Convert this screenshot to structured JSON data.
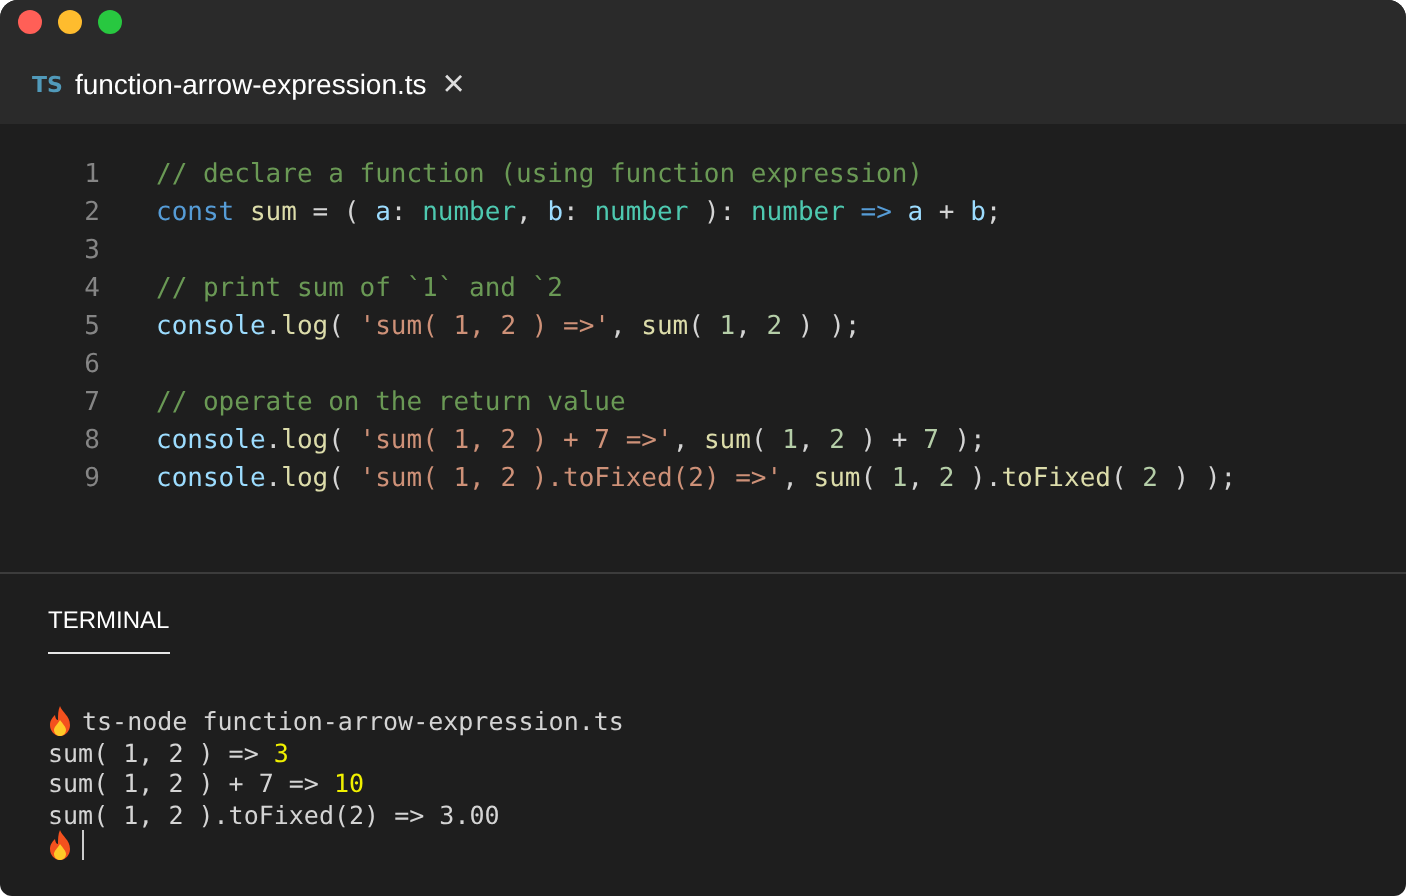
{
  "tab": {
    "badge": "TS",
    "title": "function-arrow-expression.ts",
    "close": "×"
  },
  "editor": {
    "lines": [
      {
        "number": "1",
        "tokens": [
          {
            "kind": "comment",
            "t": "// declare a function (using function expression)"
          }
        ]
      },
      {
        "number": "2",
        "tokens": [
          {
            "kind": "keyword",
            "t": "const "
          },
          {
            "kind": "func",
            "t": "sum"
          },
          {
            "kind": "plain",
            "t": " = ( "
          },
          {
            "kind": "param",
            "t": "a"
          },
          {
            "kind": "plain",
            "t": ": "
          },
          {
            "kind": "type",
            "t": "number"
          },
          {
            "kind": "plain",
            "t": ", "
          },
          {
            "kind": "param",
            "t": "b"
          },
          {
            "kind": "plain",
            "t": ": "
          },
          {
            "kind": "type",
            "t": "number"
          },
          {
            "kind": "plain",
            "t": " ): "
          },
          {
            "kind": "type",
            "t": "number "
          },
          {
            "kind": "keyword",
            "t": "=> "
          },
          {
            "kind": "param",
            "t": "a"
          },
          {
            "kind": "plain",
            "t": " + "
          },
          {
            "kind": "param",
            "t": "b"
          },
          {
            "kind": "plain",
            "t": ";"
          }
        ]
      },
      {
        "number": "3"
      },
      {
        "number": "4",
        "tokens": [
          {
            "kind": "comment",
            "t": "// print sum of `1` and `2"
          }
        ]
      },
      {
        "number": "5",
        "tokens": [
          {
            "kind": "param",
            "t": "console"
          },
          {
            "kind": "plain",
            "t": "."
          },
          {
            "kind": "func",
            "t": "log"
          },
          {
            "kind": "plain",
            "t": "( "
          },
          {
            "kind": "str",
            "t": "'sum( 1, 2 ) =>'"
          },
          {
            "kind": "plain",
            "t": ", "
          },
          {
            "kind": "func",
            "t": "sum"
          },
          {
            "kind": "plain",
            "t": "( "
          },
          {
            "kind": "num",
            "t": "1"
          },
          {
            "kind": "plain",
            "t": ", "
          },
          {
            "kind": "num",
            "t": "2"
          },
          {
            "kind": "plain",
            "t": " ) );"
          }
        ]
      },
      {
        "number": "6"
      },
      {
        "number": "7",
        "tokens": [
          {
            "kind": "comment",
            "t": "// operate on the return value"
          }
        ]
      },
      {
        "number": "8",
        "tokens": [
          {
            "kind": "param",
            "t": "console"
          },
          {
            "kind": "plain",
            "t": "."
          },
          {
            "kind": "func",
            "t": "log"
          },
          {
            "kind": "plain",
            "t": "( "
          },
          {
            "kind": "str",
            "t": "'sum( 1, 2 ) + 7 =>'"
          },
          {
            "kind": "plain",
            "t": ", "
          },
          {
            "kind": "func",
            "t": "sum"
          },
          {
            "kind": "plain",
            "t": "( "
          },
          {
            "kind": "num",
            "t": "1"
          },
          {
            "kind": "plain",
            "t": ", "
          },
          {
            "kind": "num",
            "t": "2"
          },
          {
            "kind": "plain",
            "t": " ) + "
          },
          {
            "kind": "num",
            "t": "7"
          },
          {
            "kind": "plain",
            "t": " );"
          }
        ]
      },
      {
        "number": "9",
        "tokens": [
          {
            "kind": "param",
            "t": "console"
          },
          {
            "kind": "plain",
            "t": "."
          },
          {
            "kind": "func",
            "t": "log"
          },
          {
            "kind": "plain",
            "t": "( "
          },
          {
            "kind": "str",
            "t": "'sum( 1, 2 ).toFixed(2) =>'"
          },
          {
            "kind": "plain",
            "t": ", "
          },
          {
            "kind": "func",
            "t": "sum"
          },
          {
            "kind": "plain",
            "t": "( "
          },
          {
            "kind": "num",
            "t": "1"
          },
          {
            "kind": "plain",
            "t": ", "
          },
          {
            "kind": "num",
            "t": "2"
          },
          {
            "kind": "plain",
            "t": " )."
          },
          {
            "kind": "func",
            "t": "toFixed"
          },
          {
            "kind": "plain",
            "t": "( "
          },
          {
            "kind": "num",
            "t": "2"
          },
          {
            "kind": "plain",
            "t": " ) );"
          }
        ]
      }
    ]
  },
  "panel": {
    "tabs": [
      {
        "label": "TERMINAL",
        "selected": true
      }
    ],
    "lines": [
      {
        "kind": "command",
        "parts": [
          {
            "kind": "plain",
            "t": "ts-node function-arrow-expression.ts"
          }
        ]
      },
      {
        "kind": "output",
        "parts": [
          {
            "kind": "plain",
            "t": "sum( 1, 2 ) => "
          },
          {
            "kind": "value",
            "t": "3"
          }
        ]
      },
      {
        "kind": "output",
        "parts": [
          {
            "kind": "plain",
            "t": "sum( 1, 2 ) + 7 => "
          },
          {
            "kind": "value",
            "t": "10"
          }
        ]
      },
      {
        "kind": "output",
        "parts": [
          {
            "kind": "plain",
            "t": "sum( 1, 2 ).toFixed(2) => 3.00"
          }
        ]
      },
      {
        "kind": "prompt"
      }
    ]
  }
}
